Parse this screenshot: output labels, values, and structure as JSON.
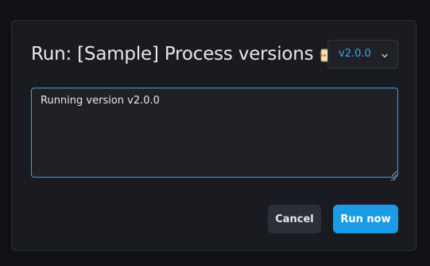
{
  "modal": {
    "title": "Run: [Sample] Process versions",
    "title_icon": "tag-icon",
    "version_select": {
      "value": "v2.0.0",
      "icon": "chevron-down-icon"
    },
    "message_value": "Running version v2.0.0",
    "cancel_label": "Cancel",
    "run_label": "Run now"
  },
  "colors": {
    "background": "#0f1115",
    "modal": "#191b21",
    "accent": "#1b9be3",
    "version_text": "#3fa7e8"
  }
}
